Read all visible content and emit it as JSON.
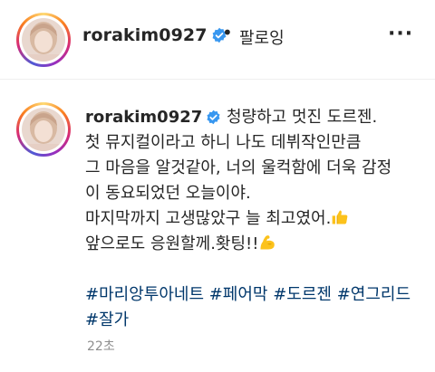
{
  "header": {
    "username": "rorakim0927",
    "separator": "•",
    "follow_label": "팔로잉",
    "more_icon": "···"
  },
  "caption": {
    "username": "rorakim0927",
    "lines": [
      "청량하고 멋진 도르젠.",
      "첫 뮤지컬이라고 하니 나도 데뷔작인만큼",
      "그 마음을 알것같아, 너의 울컥함에 더욱 감정",
      "이 동요되었던 오늘이야.",
      "마지막까지 고생많았구 늘 최고였어.",
      "앞으로도 응원할께.홧팅!!"
    ],
    "emojis": [
      "thumbs-up",
      "flexed-biceps"
    ],
    "hashtags_line1": "#마리앙투아네트 #페어막 #도르젠 #연그리드",
    "hashtags_line2": "#잘가"
  },
  "timestamp": "22초",
  "colors": {
    "verified": "#3897f0",
    "hashtag": "#00376b",
    "timestamp": "#8e8e8e"
  }
}
